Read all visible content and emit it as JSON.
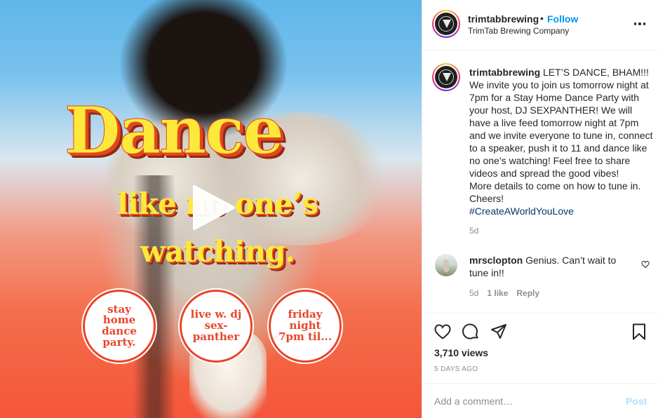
{
  "media": {
    "headline": "Dance",
    "subline_1": "like no one’s",
    "subline_2": "watching.",
    "badges": [
      "stay home dance party.",
      "live w. dj sex- panther",
      "friday night 7pm til..."
    ],
    "play_icon": "play-icon"
  },
  "header": {
    "username": "trimtabbrewing",
    "separator": "•",
    "follow_label": "Follow",
    "full_name": "TrimTab Brewing Company",
    "more_icon": "more-options-icon"
  },
  "caption": {
    "username": "trimtabbrewing",
    "text": " LET’S DANCE, BHAM!!! We invite you to join us tomorrow night at 7pm for a Stay Home Dance Party with your host, DJ SEXPANTHER! We will have a live feed tomorrow night at 7pm and we invite everyone to tune in, connect to a speaker, push it to 11 and dance like no one’s watching! Feel free to share videos and spread the good vibes!",
    "text_2": "More details to come on how to tune in. Cheers!",
    "hashtag": "#CreateAWorldYouLove",
    "time": "5d"
  },
  "comment": {
    "username": "mrsclopton",
    "text": " Genius. Can’t wait to tune in!!",
    "time": "5d",
    "likes": "1 like",
    "reply_label": "Reply"
  },
  "actions": {
    "views": "3,710 views",
    "posted": "5 DAYS AGO"
  },
  "add_comment": {
    "placeholder": "Add a comment…",
    "post_label": "Post"
  },
  "colors": {
    "accent_blue": "#0095f6",
    "post_disabled": "#b2dffc",
    "hashtag": "#00376b",
    "muted": "#8e8e8e",
    "badge_red": "#e8452a",
    "headline_yellow": "#fde93a"
  }
}
